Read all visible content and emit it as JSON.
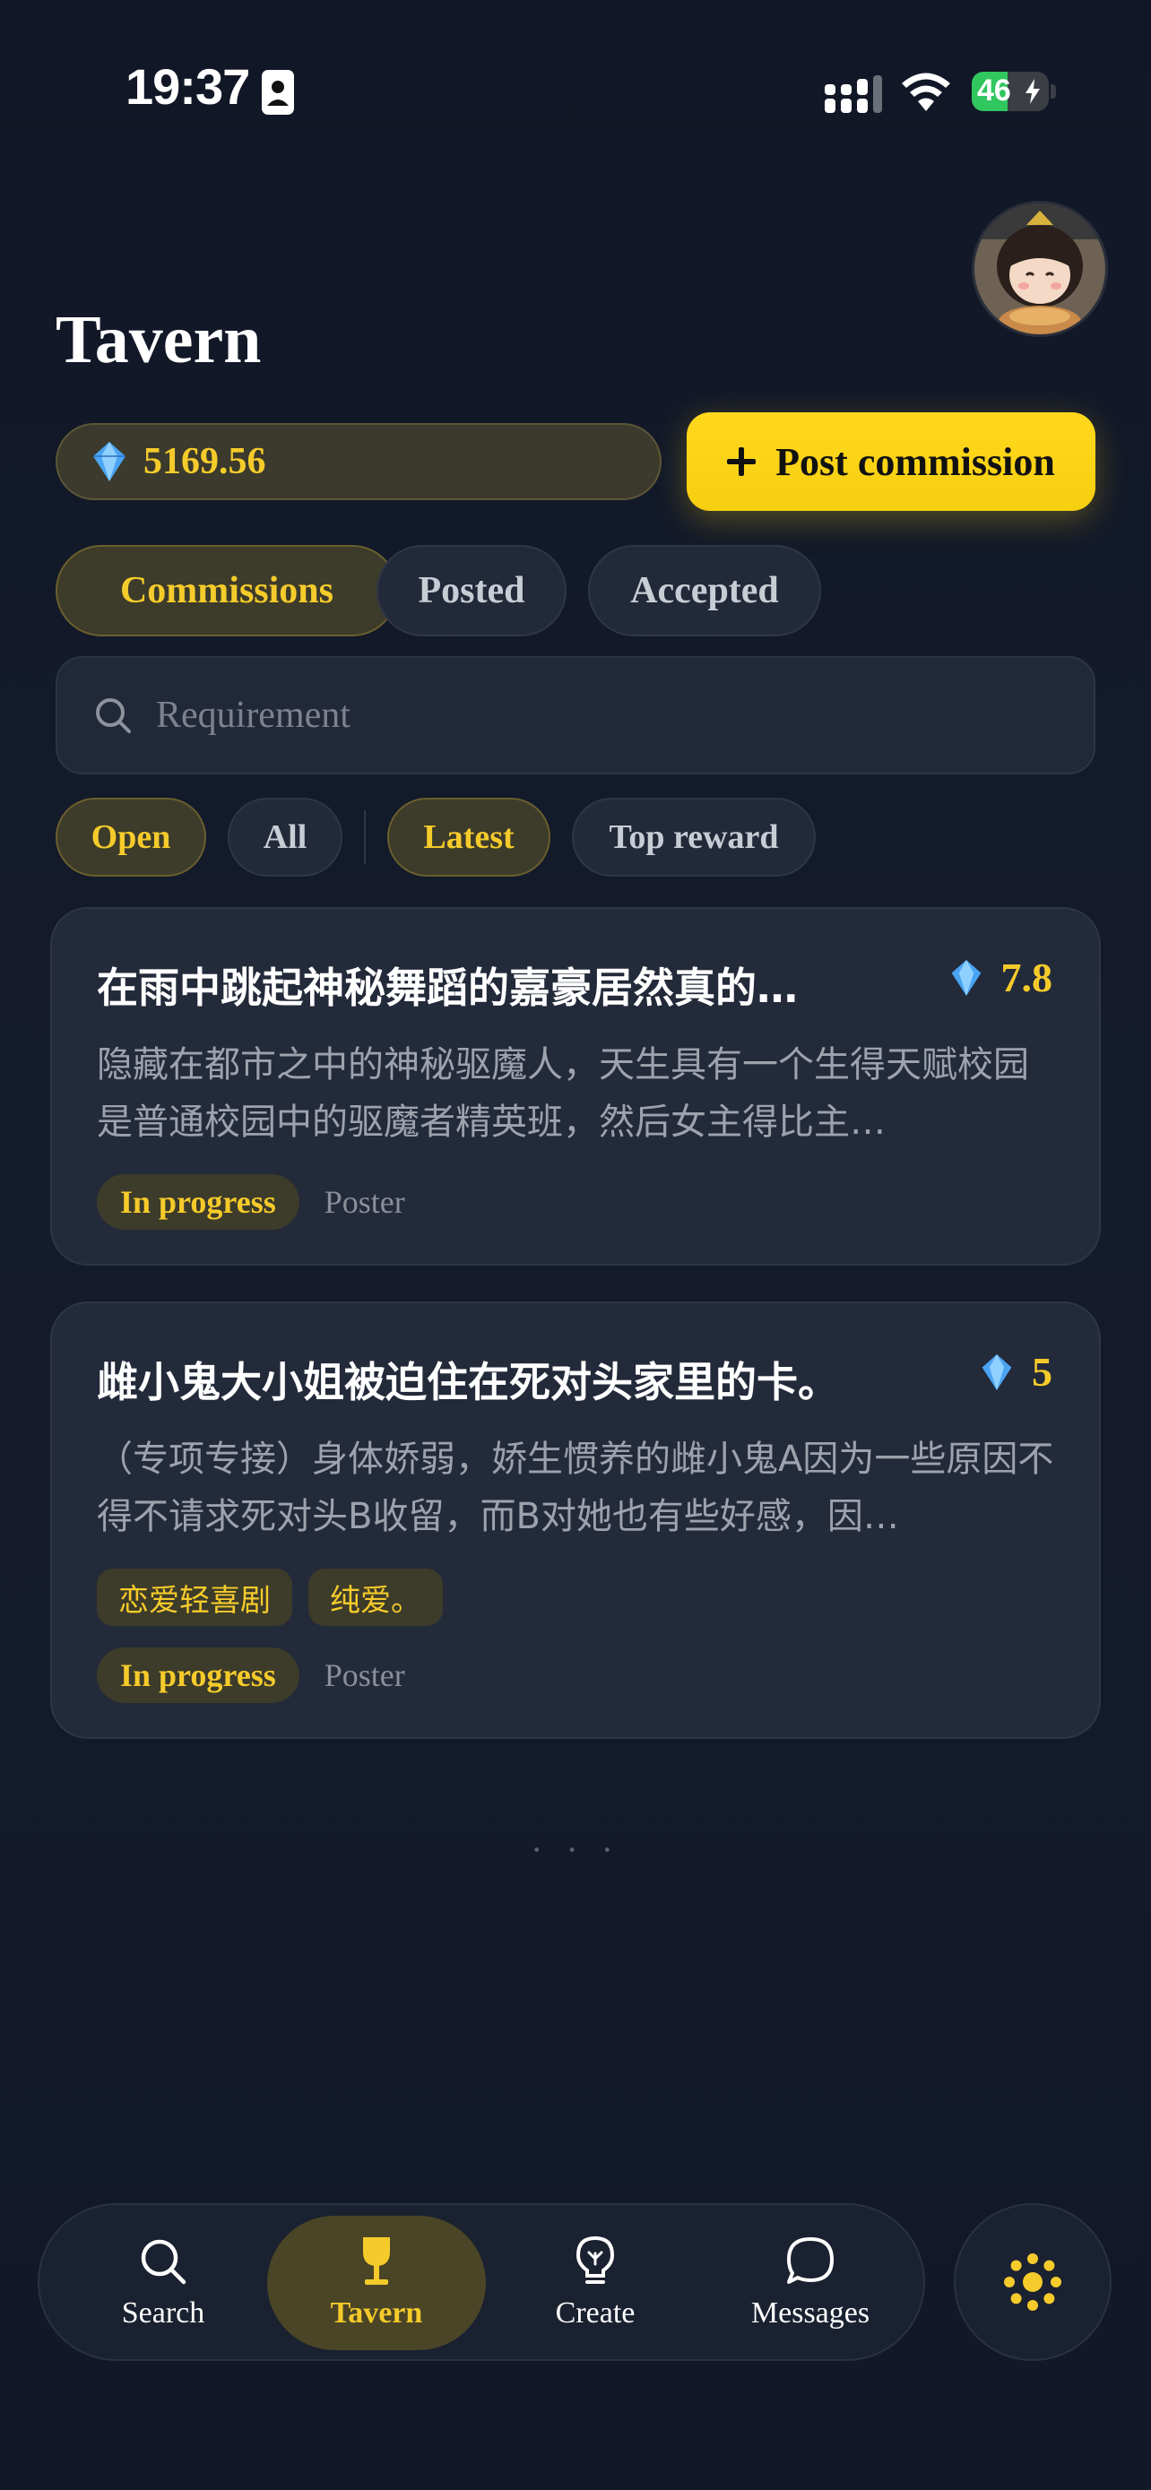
{
  "status_bar": {
    "time": "19:37",
    "battery": "46",
    "battery_level": 0.46
  },
  "header": {
    "title": "Tavern"
  },
  "balance": {
    "value": "5169.56"
  },
  "post_button": {
    "label": "Post commission"
  },
  "tabs": [
    {
      "label": "Commissions",
      "active": true
    },
    {
      "label": "Posted",
      "active": false
    },
    {
      "label": "Accepted",
      "active": false
    }
  ],
  "search": {
    "placeholder": "Requirement",
    "value": ""
  },
  "filters": [
    {
      "label": "Open",
      "active": true
    },
    {
      "label": "All",
      "active": false
    },
    {
      "label": "Latest",
      "active": true
    },
    {
      "label": "Top reward",
      "active": false
    }
  ],
  "commissions": [
    {
      "title": "在雨中跳起神秘舞蹈的嘉豪居然真的…",
      "reward": "7.8",
      "description": "隐藏在都市之中的神秘驱魔人，天生具有一个生得天赋校园是普通校园中的驱魔者精英班，然后女主得比主…",
      "tags": [],
      "status": "In progress",
      "poster_label": "Poster"
    },
    {
      "title": "雌小鬼大小姐被迫住在死对头家里的卡。",
      "reward": "5",
      "description": "（专项专接）身体娇弱，娇生惯养的雌小鬼A因为一些原因不得不请求死对头B收留，而B对她也有些好感，因…",
      "tags": [
        "恋爱轻喜剧",
        "纯爱。"
      ],
      "status": "In progress",
      "poster_label": "Poster"
    }
  ],
  "more_indicator": "· · ·",
  "bottom_nav": [
    {
      "label": "Search",
      "icon": "search-icon",
      "active": false
    },
    {
      "label": "Tavern",
      "icon": "goblet-icon",
      "active": true
    },
    {
      "label": "Create",
      "icon": "lightbulb-icon",
      "active": false
    },
    {
      "label": "Messages",
      "icon": "chat-bubble-icon",
      "active": false
    }
  ],
  "colors": {
    "accent": "#f5cb2b",
    "button": "#ffd81c",
    "background": "#131a2a",
    "card": "#232a3a",
    "battery_green": "#30c75e"
  }
}
